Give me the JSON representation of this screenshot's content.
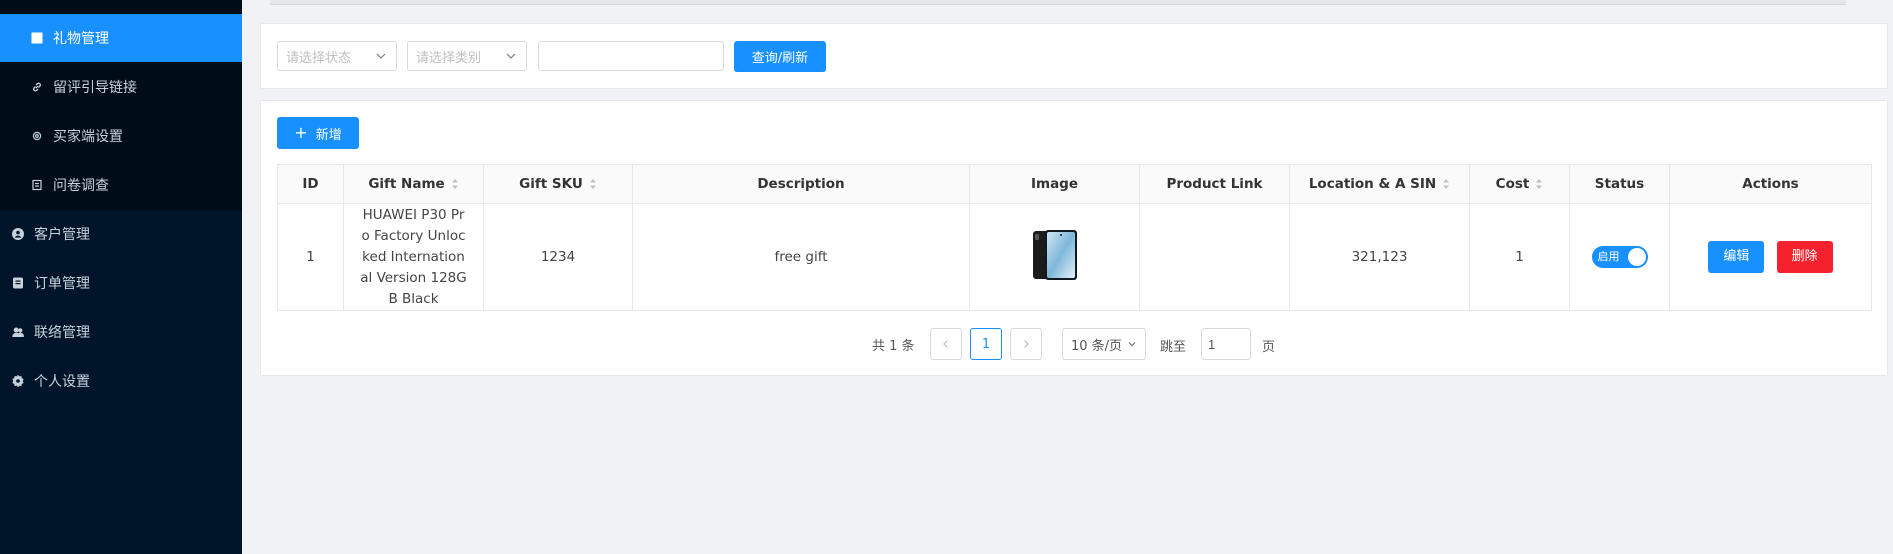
{
  "sidebar": {
    "items": [
      {
        "label": "礼物管理",
        "icon": "grid-icon",
        "active": true
      },
      {
        "label": "留评引导链接",
        "icon": "link-icon"
      },
      {
        "label": "买家端设置",
        "icon": "gear-icon"
      },
      {
        "label": "问卷调查",
        "icon": "document-icon"
      },
      {
        "label": "客户管理",
        "icon": "user-circle-icon"
      },
      {
        "label": "订单管理",
        "icon": "order-icon"
      },
      {
        "label": "联络管理",
        "icon": "contacts-icon"
      },
      {
        "label": "个人设置",
        "icon": "settings-icon"
      }
    ]
  },
  "filters": {
    "status_placeholder": "请选择状态",
    "category_placeholder": "请选择类别",
    "keyword_value": "",
    "query_button": "查询/刷新"
  },
  "toolbar": {
    "add_button": "新增"
  },
  "table": {
    "columns": [
      "ID",
      "Gift Name",
      "Gift SKU",
      "Description",
      "Image",
      "Product Link",
      "Location & A SIN",
      "Cost",
      "Status",
      "Actions"
    ],
    "rows": [
      {
        "id": "1",
        "gift_name": "HUAWEI P30 Pro Factory Unlocked International Version 128GB Black",
        "gift_sku": "1234",
        "description": "free gift",
        "image": "phone-image",
        "product_link": "",
        "location_asin": "321,123",
        "cost": "1",
        "status": "启用",
        "edit_label": "编辑",
        "delete_label": "删除"
      }
    ]
  },
  "pagination": {
    "total": "共 1 条",
    "current_page": "1",
    "page_size": "10 条/页",
    "jump_label": "跳至",
    "jump_value": "1",
    "page_label": "页"
  },
  "colors": {
    "sidebar_bg": "#001529",
    "primary": "#1890ff",
    "danger": "#f5222d"
  }
}
